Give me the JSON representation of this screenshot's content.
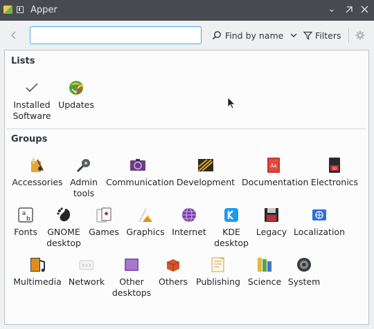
{
  "window": {
    "title": "Apper"
  },
  "toolbar": {
    "search_value": "",
    "find_by_label": "Find by name",
    "filters_label": "Filters"
  },
  "lists": {
    "title": "Lists",
    "items": [
      {
        "label": "Installed\nSoftware",
        "icon": "checkmark-icon"
      },
      {
        "label": "Updates",
        "icon": "updates-icon"
      }
    ]
  },
  "groups": {
    "title": "Groups",
    "items": [
      {
        "label": "Accessories",
        "icon": "accessories-icon"
      },
      {
        "label": "Admin\ntools",
        "icon": "admin-tools-icon"
      },
      {
        "label": "Communication",
        "icon": "communication-icon"
      },
      {
        "label": "Development",
        "icon": "development-icon"
      },
      {
        "label": "Documentation",
        "icon": "documentation-icon"
      },
      {
        "label": "Electronics",
        "icon": "electronics-icon"
      },
      {
        "label": "Fonts",
        "icon": "fonts-icon"
      },
      {
        "label": "GNOME\ndesktop",
        "icon": "gnome-icon"
      },
      {
        "label": "Games",
        "icon": "games-icon"
      },
      {
        "label": "Graphics",
        "icon": "graphics-icon"
      },
      {
        "label": "Internet",
        "icon": "internet-icon"
      },
      {
        "label": "KDE\ndesktop",
        "icon": "kde-icon"
      },
      {
        "label": "Legacy",
        "icon": "legacy-icon"
      },
      {
        "label": "Localization",
        "icon": "localization-icon"
      },
      {
        "label": "Multimedia",
        "icon": "multimedia-icon"
      },
      {
        "label": "Network",
        "icon": "network-icon"
      },
      {
        "label": "Other\ndesktops",
        "icon": "other-desktops-icon"
      },
      {
        "label": "Others",
        "icon": "others-icon"
      },
      {
        "label": "Publishing",
        "icon": "publishing-icon"
      },
      {
        "label": "Science",
        "icon": "science-icon"
      },
      {
        "label": "System",
        "icon": "system-icon"
      }
    ]
  }
}
